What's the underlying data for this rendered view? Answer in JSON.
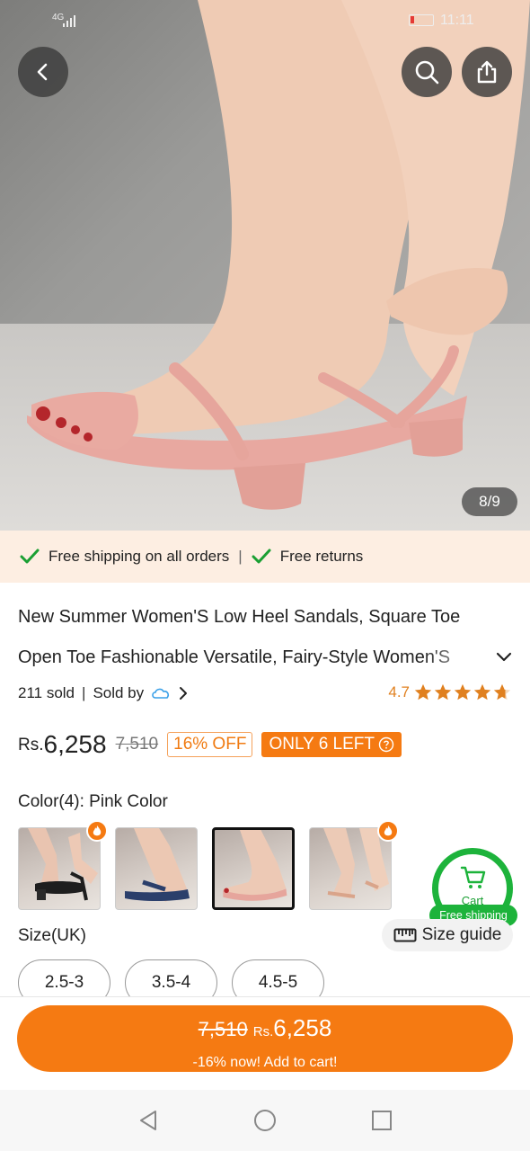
{
  "status_bar": {
    "network": "4G",
    "time": "11:11"
  },
  "gallery": {
    "pager": "8/9"
  },
  "shipping_bar": {
    "item1": "Free shipping on all orders",
    "item2": "Free returns"
  },
  "product": {
    "title_line1": "New Summer Women'S Low Heel Sandals, Square Toe",
    "title_line2": "Open Toe Fashionable Versatile, Fairy-Style Women'S",
    "sold": "211 sold",
    "sold_by": "Sold by",
    "rating": "4.7",
    "stars": 4.7
  },
  "pricing": {
    "currency": "Rs.",
    "price": "6,258",
    "original_price": "7,510",
    "discount_badge": "16% OFF",
    "stock_badge": "ONLY 6 LEFT"
  },
  "color": {
    "label": "Color(4): Pink Color",
    "options": [
      "black",
      "navy",
      "pink",
      "apricot"
    ],
    "selected_index": 2
  },
  "cart_fab": {
    "label": "Cart",
    "badge": "Free shipping"
  },
  "size": {
    "label": "Size(UK)",
    "guide": "Size guide",
    "options": [
      "2.5-3",
      "3.5-4",
      "4.5-5"
    ]
  },
  "add_to_cart": {
    "original": "7,510",
    "currency": "Rs.",
    "price": "6,258",
    "sub": "-16% now! Add to cart!"
  },
  "colors": {
    "accent": "#f57a12",
    "green": "#1db33b",
    "ship_bg": "#fdeee2",
    "star": "#e0801f"
  }
}
